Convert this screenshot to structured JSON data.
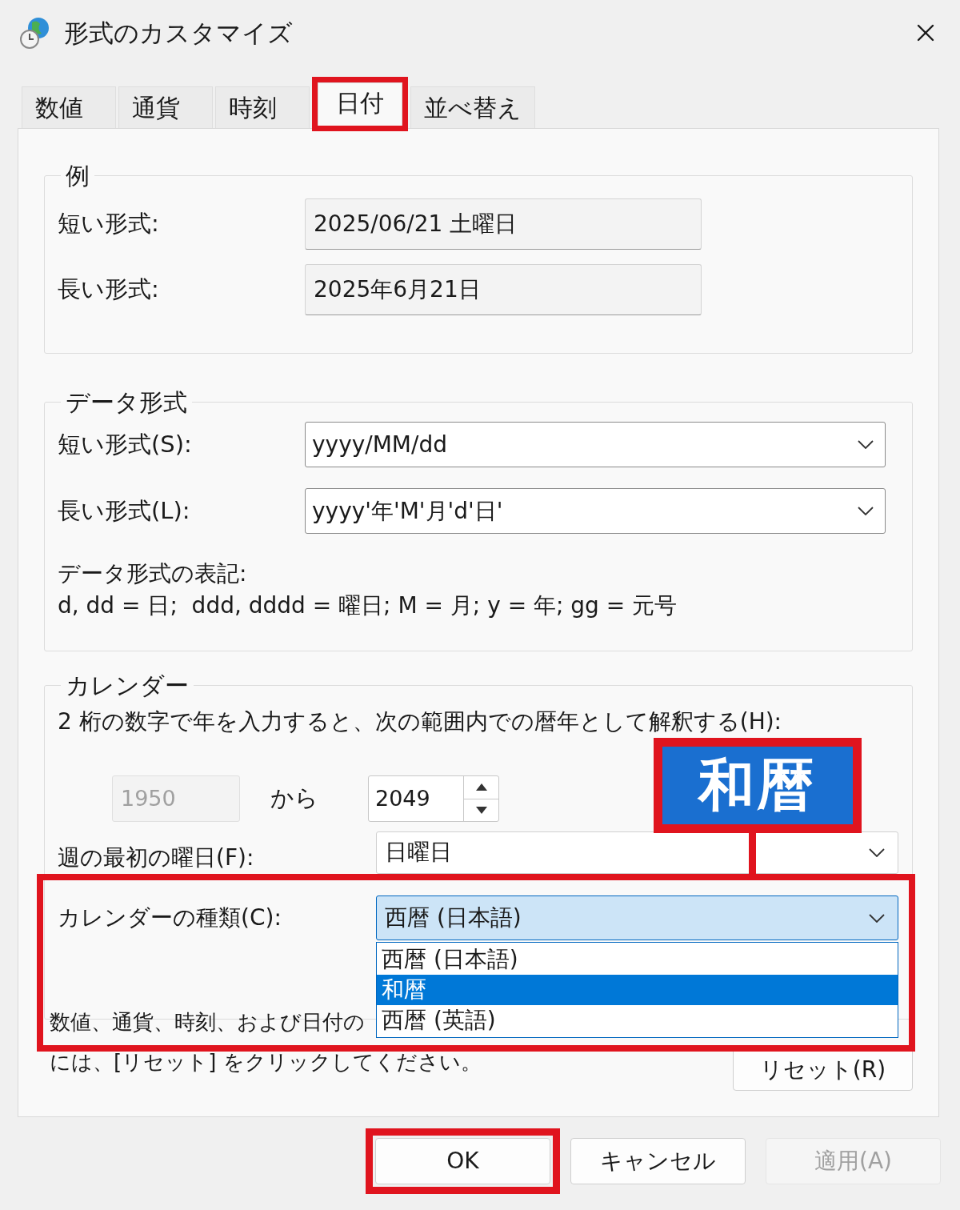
{
  "window": {
    "title": "形式のカスタマイズ"
  },
  "tabs": [
    {
      "label": "数値",
      "selected": false
    },
    {
      "label": "通貨",
      "selected": false
    },
    {
      "label": "時刻",
      "selected": false
    },
    {
      "label": "日付",
      "selected": true,
      "highlighted": true
    },
    {
      "label": "並べ替え",
      "selected": false
    }
  ],
  "example": {
    "legend": "例",
    "rows": [
      {
        "label": "短い形式:",
        "value": "2025/06/21 土曜日"
      },
      {
        "label": "長い形式:",
        "value": "2025年6月21日"
      }
    ]
  },
  "data_format": {
    "legend": "データ形式",
    "rows": [
      {
        "label": "短い形式(S):",
        "value": "yyyy/MM/dd"
      },
      {
        "label": "長い形式(L):",
        "value": "yyyy'年'M'月'd'日'"
      }
    ],
    "notation_title": "データ形式の表記:",
    "notation": "d, dd = 日;  ddd, dddd = 曜日; M = 月; y = 年; gg = 元号"
  },
  "calendar": {
    "legend": "カレンダー",
    "two_digit_label": "2 桁の数字で年を入力すると、次の範囲内での暦年として解釈する(H):",
    "from": {
      "value": "1950",
      "disabled": true
    },
    "separator": "から",
    "to": "2049",
    "first_day": {
      "label": "週の最初の曜日(F):",
      "value": "日曜日"
    },
    "calendar_type": {
      "label": "カレンダーの種類(C):",
      "value": "西暦 (日本語)",
      "expanded": true,
      "options": [
        {
          "label": "西暦 (日本語)",
          "highlighted": false
        },
        {
          "label": "和暦",
          "highlighted": true
        },
        {
          "label": "西暦 (英語)",
          "highlighted": false
        }
      ]
    }
  },
  "reset_note": [
    "数値、通貨、時刻、および日付の",
    "には、[リセット] をクリックしてください。"
  ],
  "reset_button": "リセット(R)",
  "buttons": [
    {
      "label": "OK",
      "disabled": false,
      "highlighted": true
    },
    {
      "label": "キャンセル",
      "disabled": false,
      "highlighted": false
    },
    {
      "label": "適用(A)",
      "disabled": true,
      "highlighted": false
    }
  ],
  "callout": {
    "text": "和暦"
  }
}
